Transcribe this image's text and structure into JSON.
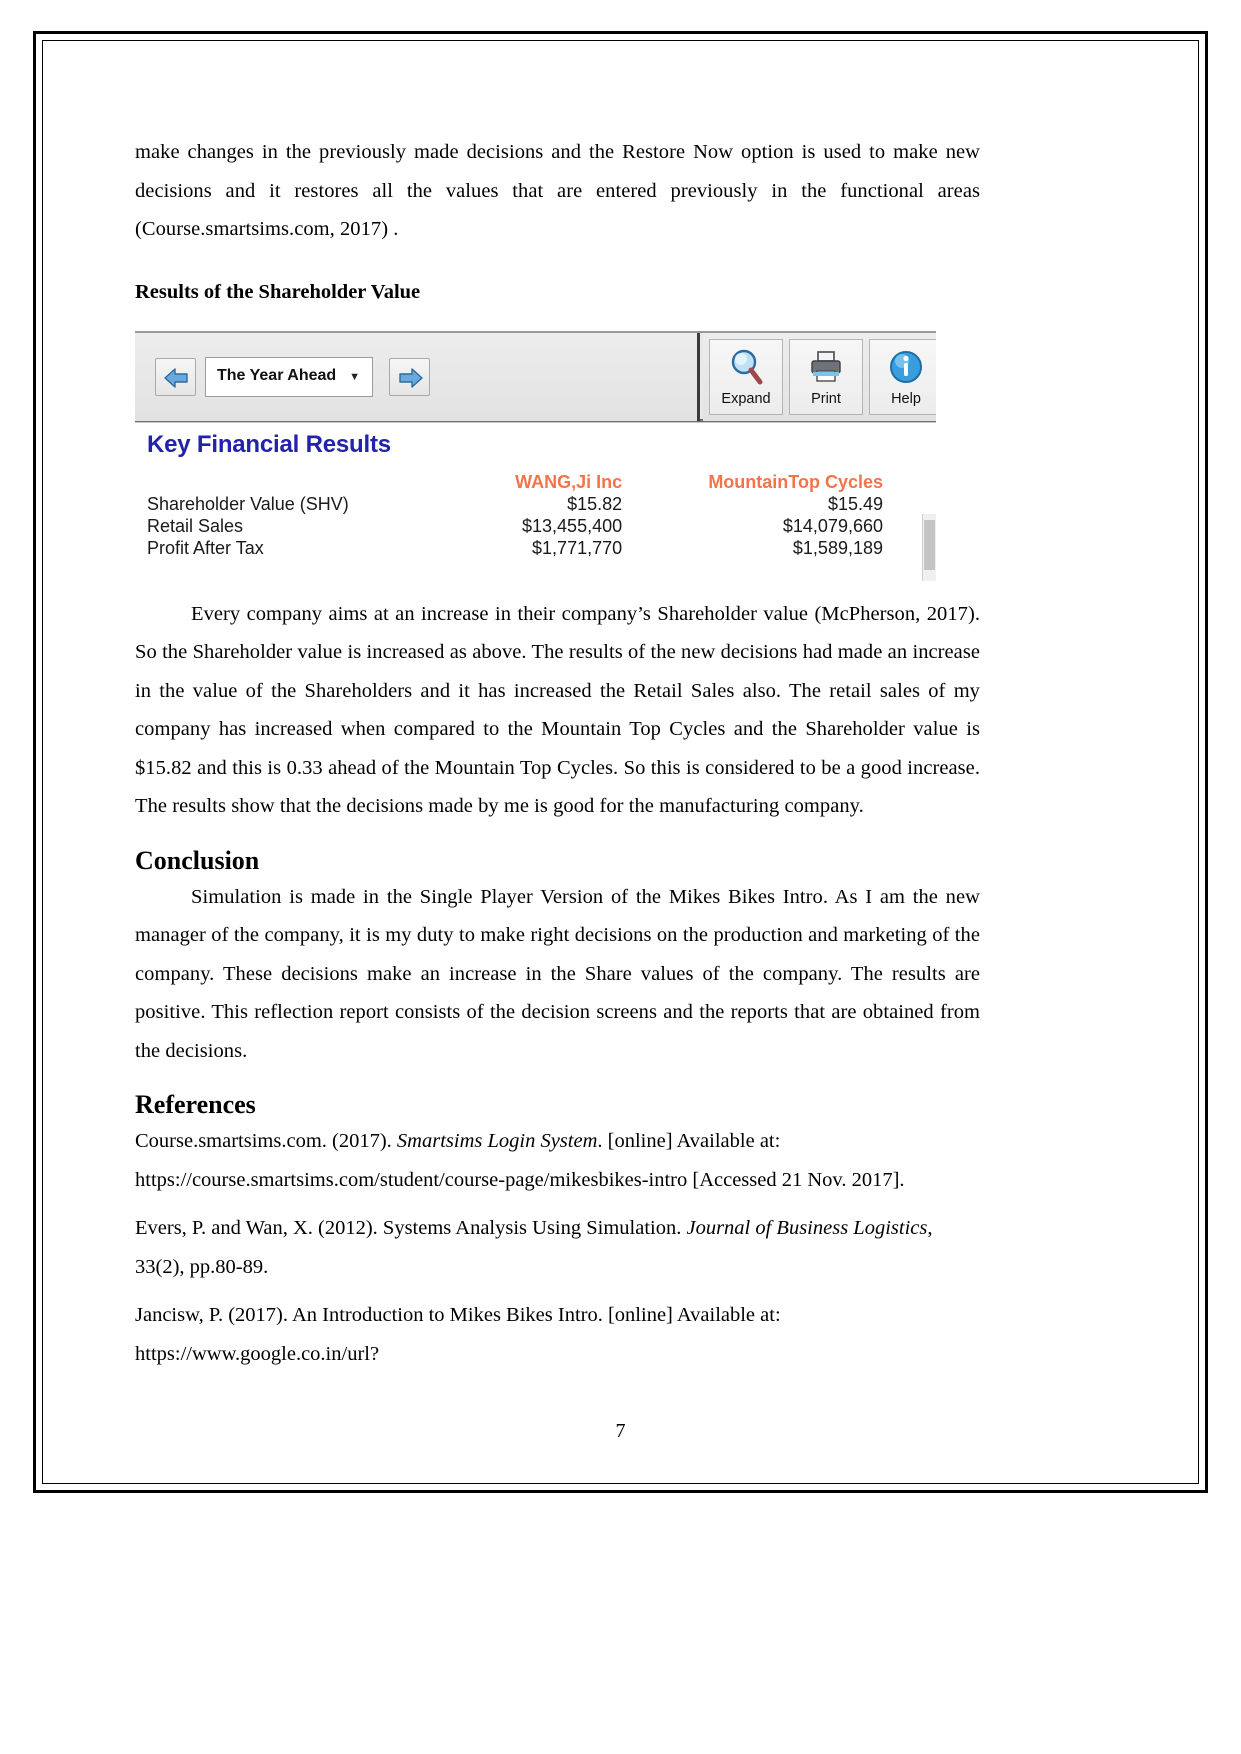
{
  "document": {
    "page_number": "7",
    "intro_paragraph": "make changes in the previously made decisions and the Restore Now option is used to make new decisions and it restores all the values that are entered previously in the functional areas (Course.smartsims.com, 2017) .",
    "shareholder_heading": "Results of the Shareholder Value",
    "shareholder_paragraph": "Every company aims at an increase in their company’s Shareholder value (McPherson, 2017). So the Shareholder value is increased as above. The results of the new decisions had made an increase in the value of the Shareholders and it has increased the Retail Sales also. The retail sales of my company has increased when compared to the Mountain Top Cycles and the Shareholder value is $15.82 and this is 0.33 ahead of the Mountain Top Cycles. So this is considered to be a good increase. The results show that the decisions made by me is good for the manufacturing company.",
    "conclusion_heading": "Conclusion",
    "conclusion_paragraph": "Simulation is made in the Single Player Version of the Mikes Bikes Intro. As I am the new manager of the company, it is my duty to make right decisions on the production and marketing of the company. These decisions make an increase in the Share values of the company. The results are positive. This reflection report consists of the decision screens and the reports that are obtained from the decisions.",
    "references_heading": "References"
  },
  "references": [
    {
      "part1": "Course.smartsims.com. (2017). ",
      "italic": "Smartsims Login System",
      "part2": ". [online] Available at: https://course.smartsims.com/student/course-page/mikesbikes-intro [Accessed 21 Nov. 2017]."
    },
    {
      "part1": "Evers, P. and Wan, X. (2012). Systems Analysis Using Simulation. ",
      "italic": "Journal of Business Logistics",
      "part2": ", 33(2), pp.80-89."
    },
    {
      "part1": "Jancisw, P. (2017). An Introduction to Mikes Bikes Intro. [online] Available at: https://www.google.co.in/url?",
      "italic": "",
      "part2": ""
    }
  ],
  "screenshot": {
    "toolbar": {
      "prev_icon": "left-arrow-icon",
      "next_icon": "right-arrow-icon",
      "year_select_value": "The Year Ahead",
      "caret_icon": "chevron-down-icon",
      "buttons": [
        {
          "label": "Expand",
          "icon": "magnifier-icon"
        },
        {
          "label": "Print",
          "icon": "printer-icon"
        },
        {
          "label": "Help",
          "icon": "info-icon"
        }
      ]
    },
    "report": {
      "title": "Key Financial Results",
      "title_color": "#2222aa",
      "header_color": "#f4744a",
      "columns": [
        "",
        "WANG,Ji Inc",
        "MountainTop Cycles"
      ],
      "rows": [
        {
          "label": "Shareholder Value (SHV)",
          "wang": "$15.82",
          "mountaintop": "$15.49"
        },
        {
          "label": "Retail Sales",
          "wang": "$13,455,400",
          "mountaintop": "$14,079,660"
        },
        {
          "label": "Profit After Tax",
          "wang": "$1,771,770",
          "mountaintop": "$1,589,189"
        }
      ]
    }
  }
}
